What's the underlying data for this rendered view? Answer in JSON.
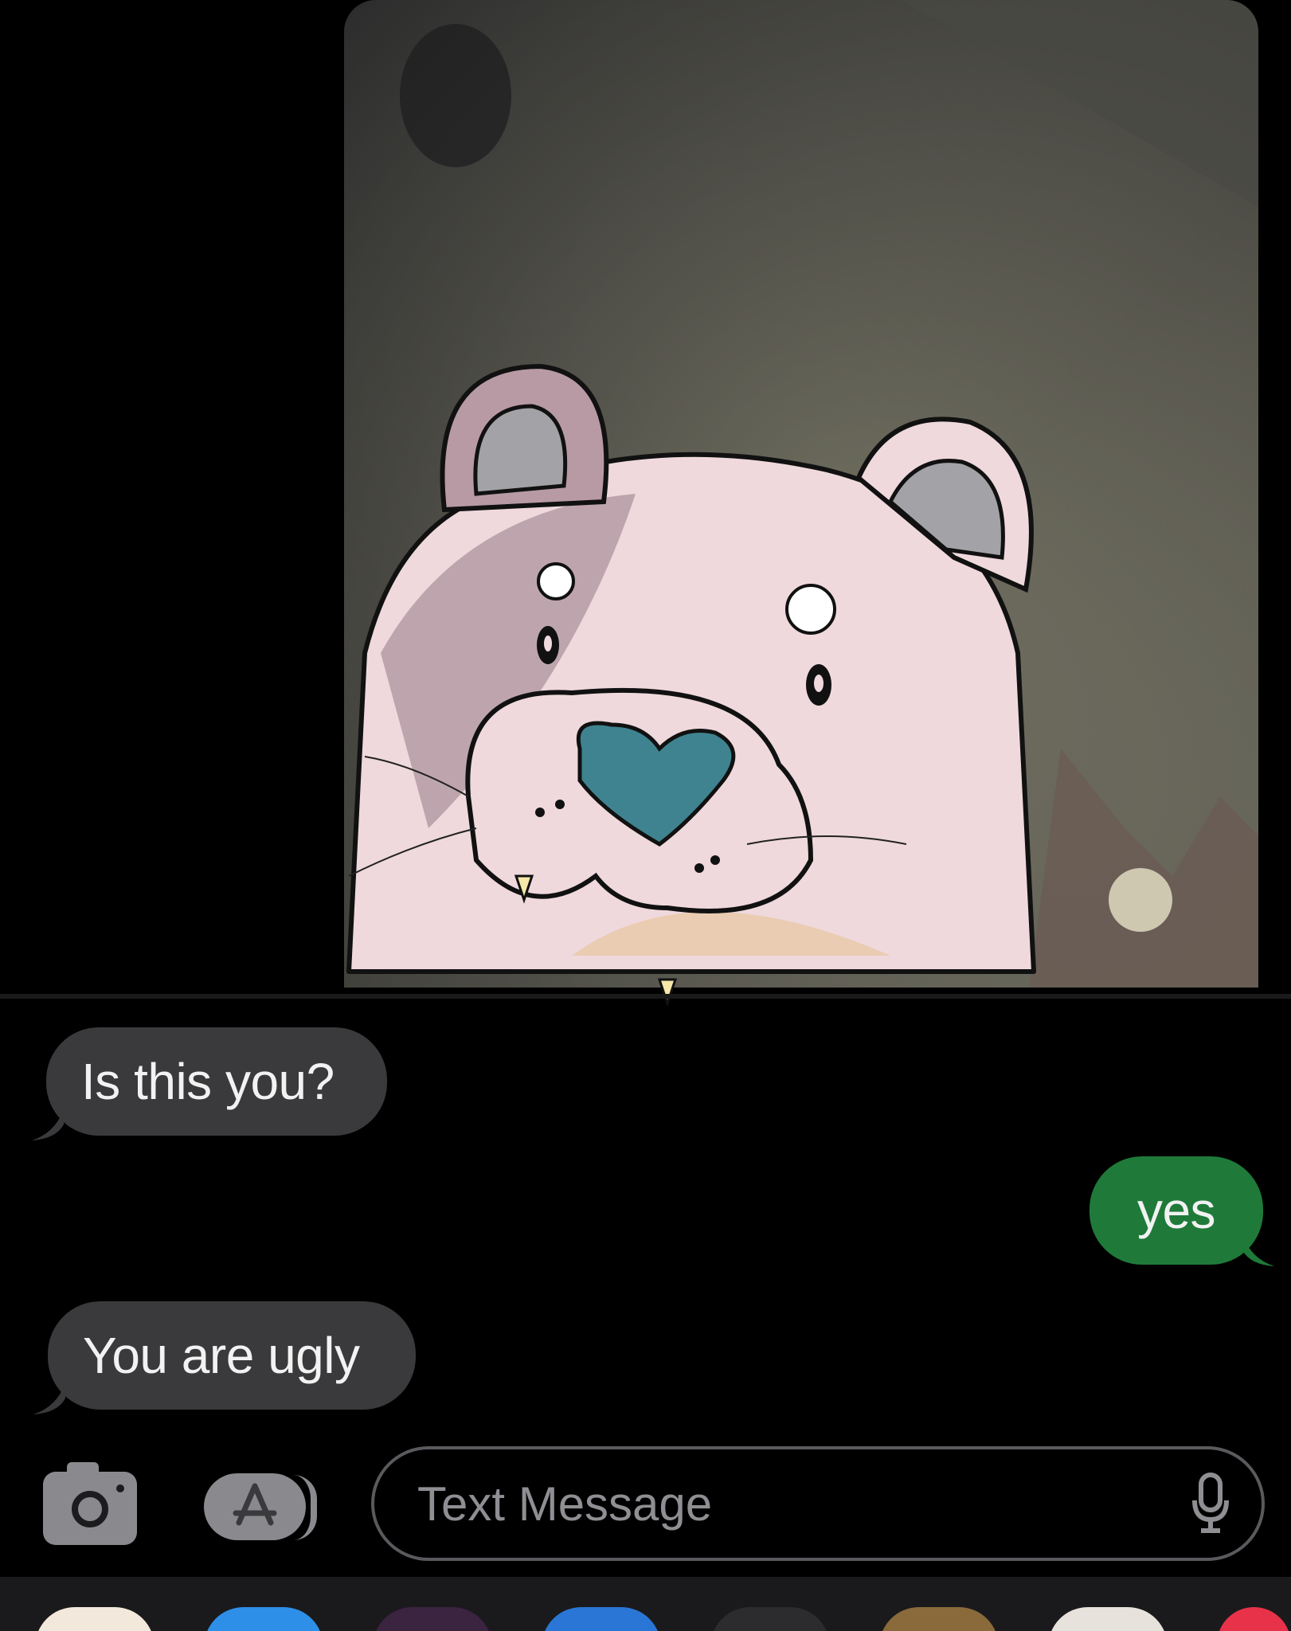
{
  "conversation": {
    "messages": [
      {
        "side": "received",
        "text": "Is this you?"
      },
      {
        "side": "sent",
        "text": "yes"
      },
      {
        "side": "received",
        "text": "You are ugly"
      }
    ]
  },
  "composer": {
    "placeholder": "Text Message",
    "camera_icon": "camera-icon",
    "apps_icon": "app-store-icon",
    "mic_icon": "microphone-icon"
  },
  "colors": {
    "received_bubble": "#3a3a3c",
    "sent_bubble": "#1f7a3a",
    "background": "#000000"
  }
}
